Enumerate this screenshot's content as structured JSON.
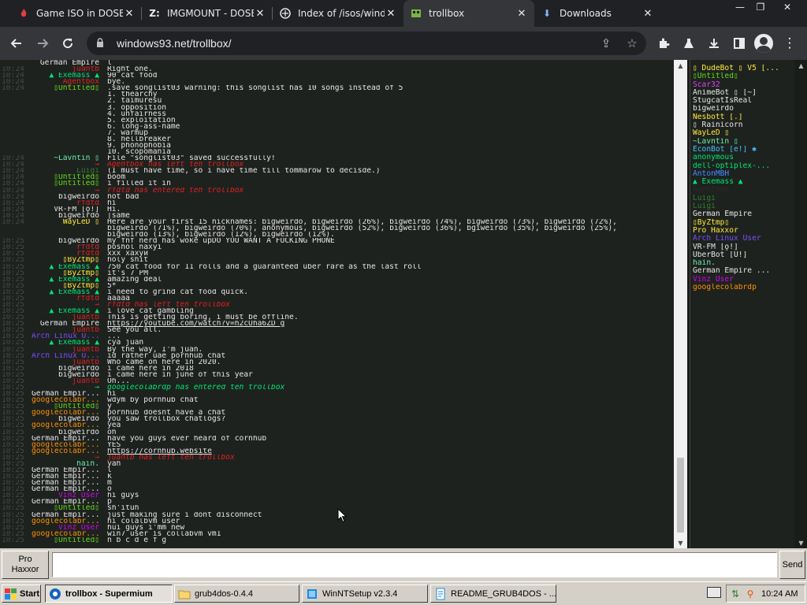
{
  "browser": {
    "tabs": [
      {
        "title": "Game ISO in DOSBo",
        "icon": "dosbox-icon",
        "icon_color": "#e04040"
      },
      {
        "title": "IMGMOUNT - DOSB",
        "icon": "z-icon",
        "icon_color": "#e8eaed"
      },
      {
        "title": "Index of /isos/wind",
        "icon": "archive-icon",
        "icon_color": "#e8eaed"
      },
      {
        "title": "trollbox",
        "icon": "trollbox-icon",
        "icon_color": "#7cb342",
        "active": true
      },
      {
        "title": "Downloads",
        "icon": "download-icon",
        "icon_color": "#8ab4f8"
      }
    ],
    "url": "windows93.net/trollbox/"
  },
  "chat_lines": [
    {
      "ts": "",
      "nick": "German Empire",
      "nick_color": "#e6e6e6",
      "msg": "l",
      "style": ""
    },
    {
      "ts": "10:24",
      "nick": "juantb",
      "nick_color": "#e02020",
      "msg": "Right one.",
      "style": ""
    },
    {
      "ts": "10:24",
      "nick": "▲ Exemass ▲",
      "nick_color": "#00e676",
      "msg": "90 cat food",
      "style": ""
    },
    {
      "ts": "10:24",
      "nick": "Agentbox",
      "nick_color": "#e02020",
      "msg": "bye.",
      "style": ""
    },
    {
      "ts": "10:24",
      "nick": "▯Untitled▯",
      "nick_color": "#64dd17",
      "msg": ".save songlist03 warning: this songlist has 10 songs instead of 5",
      "style": ""
    },
    {
      "ts": "",
      "nick": "",
      "nick_color": "#e6e6e6",
      "msg": "1. thearchy",
      "style": ""
    },
    {
      "ts": "",
      "nick": "",
      "nick_color": "#e6e6e6",
      "msg": "2. taimuresu",
      "style": ""
    },
    {
      "ts": "",
      "nick": "",
      "nick_color": "#e6e6e6",
      "msg": "3. opposition",
      "style": ""
    },
    {
      "ts": "",
      "nick": "",
      "nick_color": "#e6e6e6",
      "msg": "4. unfairness",
      "style": ""
    },
    {
      "ts": "",
      "nick": "",
      "nick_color": "#e6e6e6",
      "msg": "5. exploitation",
      "style": ""
    },
    {
      "ts": "",
      "nick": "",
      "nick_color": "#e6e6e6",
      "msg": "6. long-ass-name",
      "style": ""
    },
    {
      "ts": "",
      "nick": "",
      "nick_color": "#e6e6e6",
      "msg": "7. warmup",
      "style": ""
    },
    {
      "ts": "",
      "nick": "",
      "nick_color": "#e6e6e6",
      "msg": "8. hellbreaker",
      "style": ""
    },
    {
      "ts": "",
      "nick": "",
      "nick_color": "#e6e6e6",
      "msg": "9. phonophobia",
      "style": ""
    },
    {
      "ts": "",
      "nick": "",
      "nick_color": "#e6e6e6",
      "msg": "10. scopomania",
      "style": ""
    },
    {
      "ts": "10:24",
      "nick": "~Lavntin ▯",
      "nick_color": "#69f0ae",
      "msg": "File \"songlist03\" saved successfully!",
      "style": ""
    },
    {
      "ts": "10:24",
      "nick": "→",
      "nick_color": "#e02020",
      "msg": "Agentbox has left teh trollbox",
      "style": "sys"
    },
    {
      "ts": "10:24",
      "nick": "Luigi",
      "nick_color": "#2e7d32",
      "msg": "(I must have time, so i have time till tommarow to decisde.)",
      "style": ""
    },
    {
      "ts": "10:24",
      "nick": "▯Untitled▯",
      "nick_color": "#64dd17",
      "msg": "boom",
      "style": ""
    },
    {
      "ts": "10:24",
      "nick": "▯Untitled▯",
      "nick_color": "#64dd17",
      "msg": "i filled it in",
      "style": ""
    },
    {
      "ts": "10:24",
      "nick": "→",
      "nick_color": "#e02020",
      "msg": "rfdtd has entered teh trollbox",
      "style": "sys"
    },
    {
      "ts": "10:24",
      "nick": "bigweirdo",
      "nick_color": "#e6e6e6",
      "msg": "not bad",
      "style": ""
    },
    {
      "ts": "10:24",
      "nick": "rfdtd",
      "nick_color": "#e02020",
      "msg": "hi",
      "style": ""
    },
    {
      "ts": "10:24",
      "nick": "VR-FM [ǫ!]",
      "nick_color": "#e6e6e6",
      "msg": "Hi.",
      "style": ""
    },
    {
      "ts": "10:24",
      "nick": "bigweirdo",
      "nick_color": "#e6e6e6",
      "msg": "|same",
      "style": ""
    },
    {
      "ts": "10:24",
      "nick": "WayLeD ▯",
      "nick_color": "#ffeb3b",
      "msg": "Here are your first 15 nicknames: bigweirdo, bigweirdo (26%), bigweirdo (74%), bigweirdo (73%), bigweirdo (72%),",
      "style": ""
    },
    {
      "ts": "",
      "nick": "",
      "nick_color": "#e6e6e6",
      "msg": "bigweirdo (71%), bigweirdo (70%), anonymous, bigweirdo (52%), bigweirdo (36%), bgiweirdo (35%), bigweirdo (25%),",
      "style": ""
    },
    {
      "ts": "",
      "nick": "",
      "nick_color": "#e6e6e6",
      "msg": "bigweirdo (13%), bigweirdo (12%), bigweirdo (12%).",
      "style": ""
    },
    {
      "ts": "10:25",
      "nick": "bigweirdo",
      "nick_color": "#e6e6e6",
      "msg": "my fnf nerd has woke upDO YOU WANT A FUCKING PHONE",
      "style": ""
    },
    {
      "ts": "10:25",
      "nick": "rfdtd",
      "nick_color": "#e02020",
      "msg": "poshol naxyi",
      "style": ""
    },
    {
      "ts": "10:25",
      "nick": "rfdtd",
      "nick_color": "#e02020",
      "msg": "ххх хахуй",
      "style": ""
    },
    {
      "ts": "10:25",
      "nick": "▯ByZtmp▯",
      "nick_color": "#ffeb3b",
      "msg": "holy shit",
      "style": ""
    },
    {
      "ts": "10:25",
      "nick": "▲ Exemass ▲",
      "nick_color": "#00e676",
      "msg": "750 cat food for 11 rolls and a guaranteed uber rare as the last roll",
      "style": ""
    },
    {
      "ts": "10:25",
      "nick": "▯ByZtmp▯",
      "nick_color": "#ffeb3b",
      "msg": "it's 7 PM",
      "style": ""
    },
    {
      "ts": "10:25",
      "nick": "▲ Exemass ▲",
      "nick_color": "#00e676",
      "msg": "amazing deal",
      "style": ""
    },
    {
      "ts": "10:25",
      "nick": "▯ByZtmp▯",
      "nick_color": "#ffeb3b",
      "msg": "5*",
      "style": ""
    },
    {
      "ts": "10:25",
      "nick": "▲ Exemass ▲",
      "nick_color": "#00e676",
      "msg": "i need to grind cat food quick.",
      "style": ""
    },
    {
      "ts": "10:25",
      "nick": "rfdtd",
      "nick_color": "#e02020",
      "msg": "ааааа",
      "style": ""
    },
    {
      "ts": "10:25",
      "nick": "→",
      "nick_color": "#e02020",
      "msg": "rfdtd has left teh trollbox",
      "style": "sys"
    },
    {
      "ts": "10:25",
      "nick": "▲ Exemass ▲",
      "nick_color": "#00e676",
      "msg": "i love cat gambling",
      "style": ""
    },
    {
      "ts": "10:25",
      "nick": "juantb",
      "nick_color": "#e02020",
      "msg": "This is getting boring, i must be offline.",
      "style": ""
    },
    {
      "ts": "10:25",
      "nick": "German Empire",
      "nick_color": "#e6e6e6",
      "msg": "https://youtube.com/watch?v=h2cUha6ZD_g",
      "style": "link"
    },
    {
      "ts": "10:25",
      "nick": "juantb",
      "nick_color": "#e02020",
      "msg": "See you all.",
      "style": ""
    },
    {
      "ts": "10:25",
      "nick": "Arch Linux U...",
      "nick_color": "#7c4dff",
      "msg": "...",
      "style": ""
    },
    {
      "ts": "10:25",
      "nick": "▲ Exemass ▲",
      "nick_color": "#00e676",
      "msg": "cya juan",
      "style": ""
    },
    {
      "ts": "10:25",
      "nick": "juantb",
      "nick_color": "#e02020",
      "msg": "By the way, I'm juan.",
      "style": ""
    },
    {
      "ts": "10:25",
      "nick": "Arch Linux U...",
      "nick_color": "#7c4dff",
      "msg": "id rather uae pornhub chat",
      "style": ""
    },
    {
      "ts": "10:25",
      "nick": "juantb",
      "nick_color": "#e02020",
      "msg": "Who came on here in 2020.",
      "style": ""
    },
    {
      "ts": "10:25",
      "nick": "bigweirdo",
      "nick_color": "#e6e6e6",
      "msg": "i came here in 2018",
      "style": ""
    },
    {
      "ts": "10:25",
      "nick": "bigweirdo",
      "nick_color": "#e6e6e6",
      "msg": "i came here in june of this year",
      "style": ""
    },
    {
      "ts": "10:25",
      "nick": "juantb",
      "nick_color": "#e02020",
      "msg": "Oh...",
      "style": ""
    },
    {
      "ts": "10:25",
      "nick": "→",
      "nick_color": "#00e676",
      "msg": "googlecolabrdp has entered teh trollbox",
      "style": "sys"
    },
    {
      "ts": "10:25",
      "nick": "German Empir...",
      "nick_color": "#e6e6e6",
      "msg": "hi",
      "style": ""
    },
    {
      "ts": "10:25",
      "nick": "googlecolabr...",
      "nick_color": "#ff9100",
      "msg": "wdym by pornhub chat",
      "style": ""
    },
    {
      "ts": "10:25",
      "nick": "▯Untitled▯",
      "nick_color": "#64dd17",
      "msg": "y",
      "style": ""
    },
    {
      "ts": "10:25",
      "nick": "googlecolabr...",
      "nick_color": "#ff9100",
      "msg": "pornhub doesnt have a chat",
      "style": ""
    },
    {
      "ts": "10:25",
      "nick": "bigweirdo",
      "nick_color": "#e6e6e6",
      "msg": "you saw trollbox chatlogs?",
      "style": ""
    },
    {
      "ts": "10:25",
      "nick": "googlecolabr...",
      "nick_color": "#ff9100",
      "msg": "yea",
      "style": ""
    },
    {
      "ts": "10:25",
      "nick": "bigweirdo",
      "nick_color": "#e6e6e6",
      "msg": "oh",
      "style": ""
    },
    {
      "ts": "10:25",
      "nick": "German Empir...",
      "nick_color": "#e6e6e6",
      "msg": "have you guys ever heard of cornhub",
      "style": ""
    },
    {
      "ts": "10:25",
      "nick": "googlecolabr...",
      "nick_color": "#ff9100",
      "msg": "YES",
      "style": ""
    },
    {
      "ts": "10:25",
      "nick": "googlecolabr...",
      "nick_color": "#ff9100",
      "msg": "https://cornhub.website",
      "style": "link"
    },
    {
      "ts": "10:25",
      "nick": "→",
      "nick_color": "#e02020",
      "msg": "juantb has left teh trollbox",
      "style": "sys"
    },
    {
      "ts": "10:25",
      "nick": "hain.",
      "nick_color": "#69f0ae",
      "msg": "yah",
      "style": ""
    },
    {
      "ts": "10:25",
      "nick": "German Empir...",
      "nick_color": "#e6e6e6",
      "msg": "l",
      "style": ""
    },
    {
      "ts": "10:25",
      "nick": "German Empir...",
      "nick_color": "#e6e6e6",
      "msg": "k",
      "style": ""
    },
    {
      "ts": "10:25",
      "nick": "German Empir...",
      "nick_color": "#e6e6e6",
      "msg": "m",
      "style": ""
    },
    {
      "ts": "10:25",
      "nick": "German Empir...",
      "nick_color": "#e6e6e6",
      "msg": "o",
      "style": ""
    },
    {
      "ts": "10:25",
      "nick": "Vinz User",
      "nick_color": "#d500f9",
      "msg": "hi guys",
      "style": ""
    },
    {
      "ts": "10:25",
      "nick": "German Empir...",
      "nick_color": "#e6e6e6",
      "msg": "p",
      "style": ""
    },
    {
      "ts": "10:25",
      "nick": "▯Untitled▯",
      "nick_color": "#64dd17",
      "msg": "sh'ituh",
      "style": ""
    },
    {
      "ts": "10:25",
      "nick": "German Empir...",
      "nick_color": "#e6e6e6",
      "msg": "just making sure i dont disconnect",
      "style": ""
    },
    {
      "ts": "10:25",
      "nick": "googlecolabr...",
      "nick_color": "#ff9100",
      "msg": "hi colalbvm user",
      "style": ""
    },
    {
      "ts": "10:25",
      "nick": "Vinz User",
      "nick_color": "#d500f9",
      "msg": "hui guys i'mm new",
      "style": ""
    },
    {
      "ts": "10:25",
      "nick": "googlecolabr...",
      "nick_color": "#ff9100",
      "msg": "win7 user is collabvm vm1",
      "style": ""
    },
    {
      "ts": "10:25",
      "nick": "▯Untitled▯",
      "nick_color": "#64dd17",
      "msg": "n b c d e f g",
      "style": ""
    }
  ],
  "users": [
    {
      "name": "▯ DudeBot ▯ V5 [...",
      "color": "#ffeb3b"
    },
    {
      "name": "▯Untitled▯",
      "color": "#64dd17"
    },
    {
      "name": "Scar32",
      "color": "#e040fb"
    },
    {
      "name": "AnimeBot ▯ [~]",
      "color": "#e6e6e6"
    },
    {
      "name": "StugcatIsReal",
      "color": "#e6e6e6"
    },
    {
      "name": "bigweirdo",
      "color": "#e6e6e6"
    },
    {
      "name": "Nesbott [.]",
      "color": "#ffeb3b"
    },
    {
      "name": "▯ Rainicorn",
      "color": "#e6e6e6"
    },
    {
      "name": "WayLeD ▯",
      "color": "#ffeb3b"
    },
    {
      "name": "~Lavntin ▯",
      "color": "#69f0ae"
    },
    {
      "name": "EconBot [e!] ✱",
      "color": "#40c4ff"
    },
    {
      "name": "anonymous",
      "color": "#00e676"
    },
    {
      "name": "dell-optiplex-...",
      "color": "#00e676"
    },
    {
      "name": "AntonMBH",
      "color": "#448aff"
    },
    {
      "name": "▲ Exemass ▲",
      "color": "#00e676"
    },
    {
      "name": "Agentbox",
      "color": "#2a2a2a"
    },
    {
      "name": "Luigi",
      "color": "#2e7d32"
    },
    {
      "name": "Luigi",
      "color": "#2e7d32"
    },
    {
      "name": "German Empire",
      "color": "#e6e6e6"
    },
    {
      "name": "▯ByZtmp▯",
      "color": "#ffeb3b"
    },
    {
      "name": "Pro Haxxor",
      "color": "#ffeb3b"
    },
    {
      "name": "Arch Linux User",
      "color": "#7c4dff"
    },
    {
      "name": "VR-FM [ǫ!]",
      "color": "#e6e6e6"
    },
    {
      "name": "UberBot [U!]",
      "color": "#e6e6e6"
    },
    {
      "name": "hain.",
      "color": "#69f0ae"
    },
    {
      "name": "German Empire ...",
      "color": "#e6e6e6"
    },
    {
      "name": "Vinz User",
      "color": "#d500f9"
    },
    {
      "name": "googlecolabrdp",
      "color": "#ff9100"
    }
  ],
  "input": {
    "nick_label_line1": "Pro",
    "nick_label_line2": "Haxxor",
    "message_value": "",
    "send_label": "Send"
  },
  "taskbar": {
    "start_label": "Start",
    "windows": [
      {
        "label": "trollbox - Supermium",
        "icon": "supermium-icon",
        "active": true
      },
      {
        "label": "grub4dos-0.4.4",
        "icon": "folder-icon",
        "active": false
      },
      {
        "label": "WinNTSetup v2.3.4",
        "icon": "setup-icon",
        "active": false
      },
      {
        "label": "README_GRUB4DOS - ...",
        "icon": "notepad-icon",
        "active": false
      }
    ],
    "clock": "10:24 AM"
  }
}
